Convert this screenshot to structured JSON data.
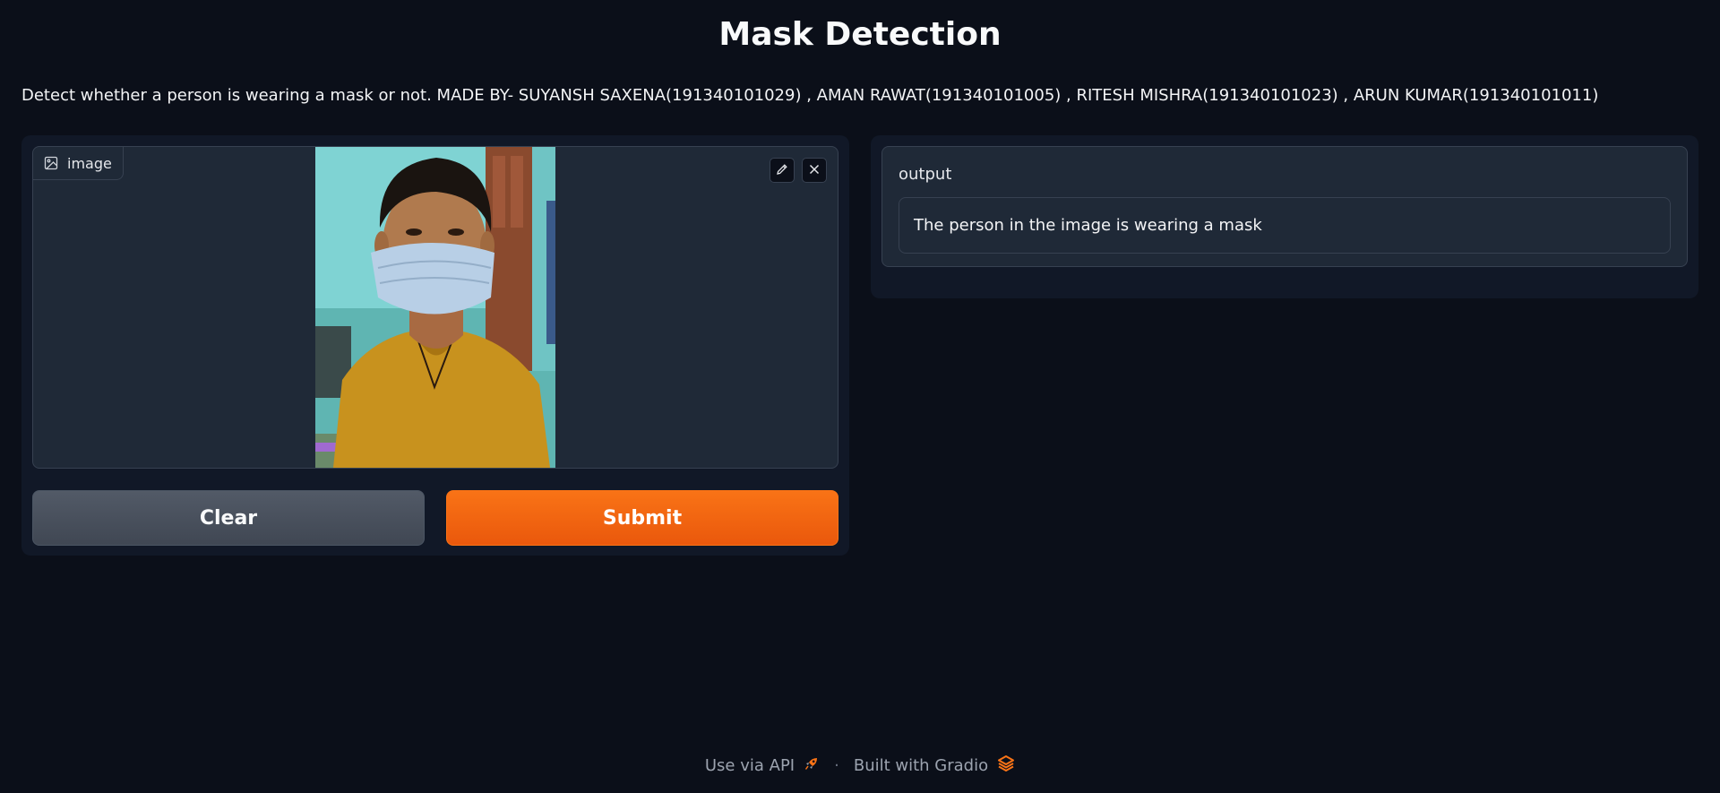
{
  "header": {
    "title": "Mask Detection",
    "description": "Detect whether a person is wearing a mask or not. MADE BY- SUYANSH SAXENA(191340101029) , AMAN RAWAT(191340101005) , RITESH MISHRA(191340101023) , ARUN KUMAR(191340101011)"
  },
  "input_panel": {
    "image_label": "image",
    "image_label_icon": "image-icon",
    "edit_icon": "pencil-icon",
    "close_icon": "close-icon"
  },
  "buttons": {
    "clear_label": "Clear",
    "submit_label": "Submit"
  },
  "output_panel": {
    "label": "output",
    "value": "The person in the image is wearing a mask"
  },
  "footer": {
    "api_label": "Use via API",
    "api_icon": "rocket-icon",
    "separator": "·",
    "built_label": "Built with Gradio",
    "built_icon": "gradio-logo-icon"
  },
  "colors": {
    "background": "#0b0f19",
    "panel": "#111827",
    "block": "#1f2937",
    "border": "#374151",
    "accent": "#f97316"
  }
}
